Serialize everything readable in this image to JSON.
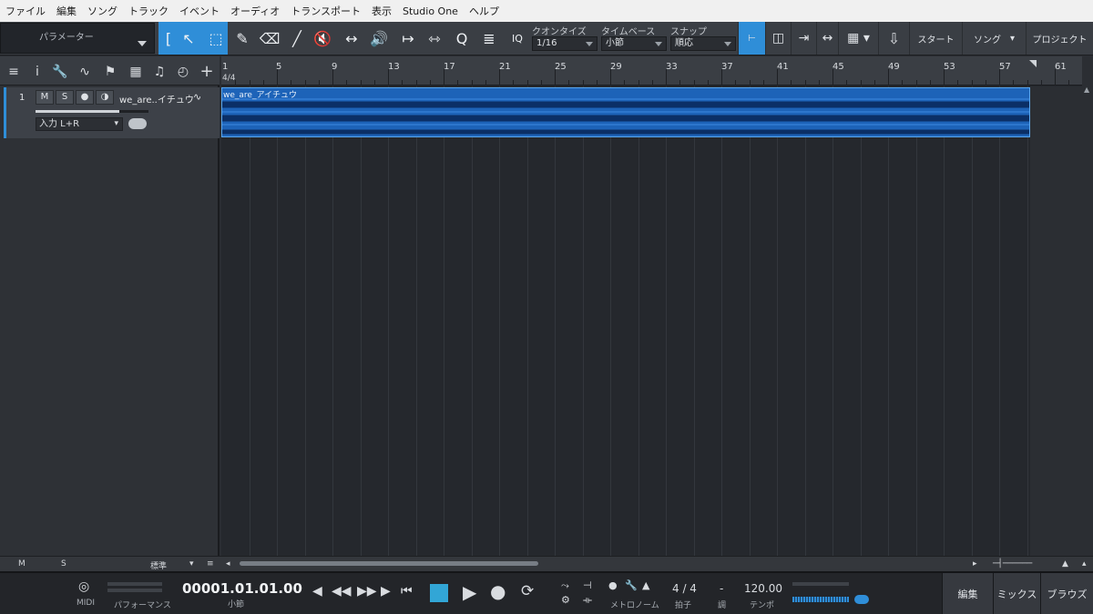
{
  "menu": [
    "ファイル",
    "編集",
    "ソング",
    "トラック",
    "イベント",
    "オーディオ",
    "トランスポート",
    "表示",
    "Studio One",
    "ヘルプ"
  ],
  "toolbar": {
    "parameter_label": "パラメーター",
    "iq_label": "IQ",
    "quantize": {
      "label": "クオンタイズ",
      "value": "1/16"
    },
    "timebase": {
      "label": "タイムベース",
      "value": "小節"
    },
    "snap": {
      "label": "スナップ",
      "value": "順応"
    },
    "start_label": "スタート",
    "song_label": "ソング",
    "project_label": "プロジェクト"
  },
  "ruler": {
    "markers": [
      "1",
      "5",
      "9",
      "13",
      "17",
      "21",
      "25",
      "29",
      "33",
      "37",
      "41",
      "45",
      "49",
      "53",
      "57",
      "61"
    ],
    "time_signature": "4/4"
  },
  "track": {
    "number": "1",
    "mute_label": "M",
    "solo_label": "S",
    "name": "we_are..イチュウ",
    "input": "入力 L+R"
  },
  "clip": {
    "name": "we_are_アイチュウ"
  },
  "bottom_strip": {
    "m_label": "M",
    "s_label": "S",
    "zoom_label": "標準"
  },
  "transport": {
    "midi_label": "MIDI",
    "performance_label": "パフォーマンス",
    "time": "00001.01.01.00",
    "time_unit": "小節",
    "metronome_label": "メトロノーム",
    "time_sig": "4 / 4",
    "time_sig_label": "拍子",
    "key": "-",
    "key_label": "調",
    "tempo": "120.00",
    "tempo_label": "テンポ",
    "edit_label": "編集",
    "mix_label": "ミックス",
    "browse_label": "ブラウズ"
  },
  "colors": {
    "accent": "#2f8ed8",
    "clip": "#1d63b8",
    "stop": "#32a6d6"
  }
}
